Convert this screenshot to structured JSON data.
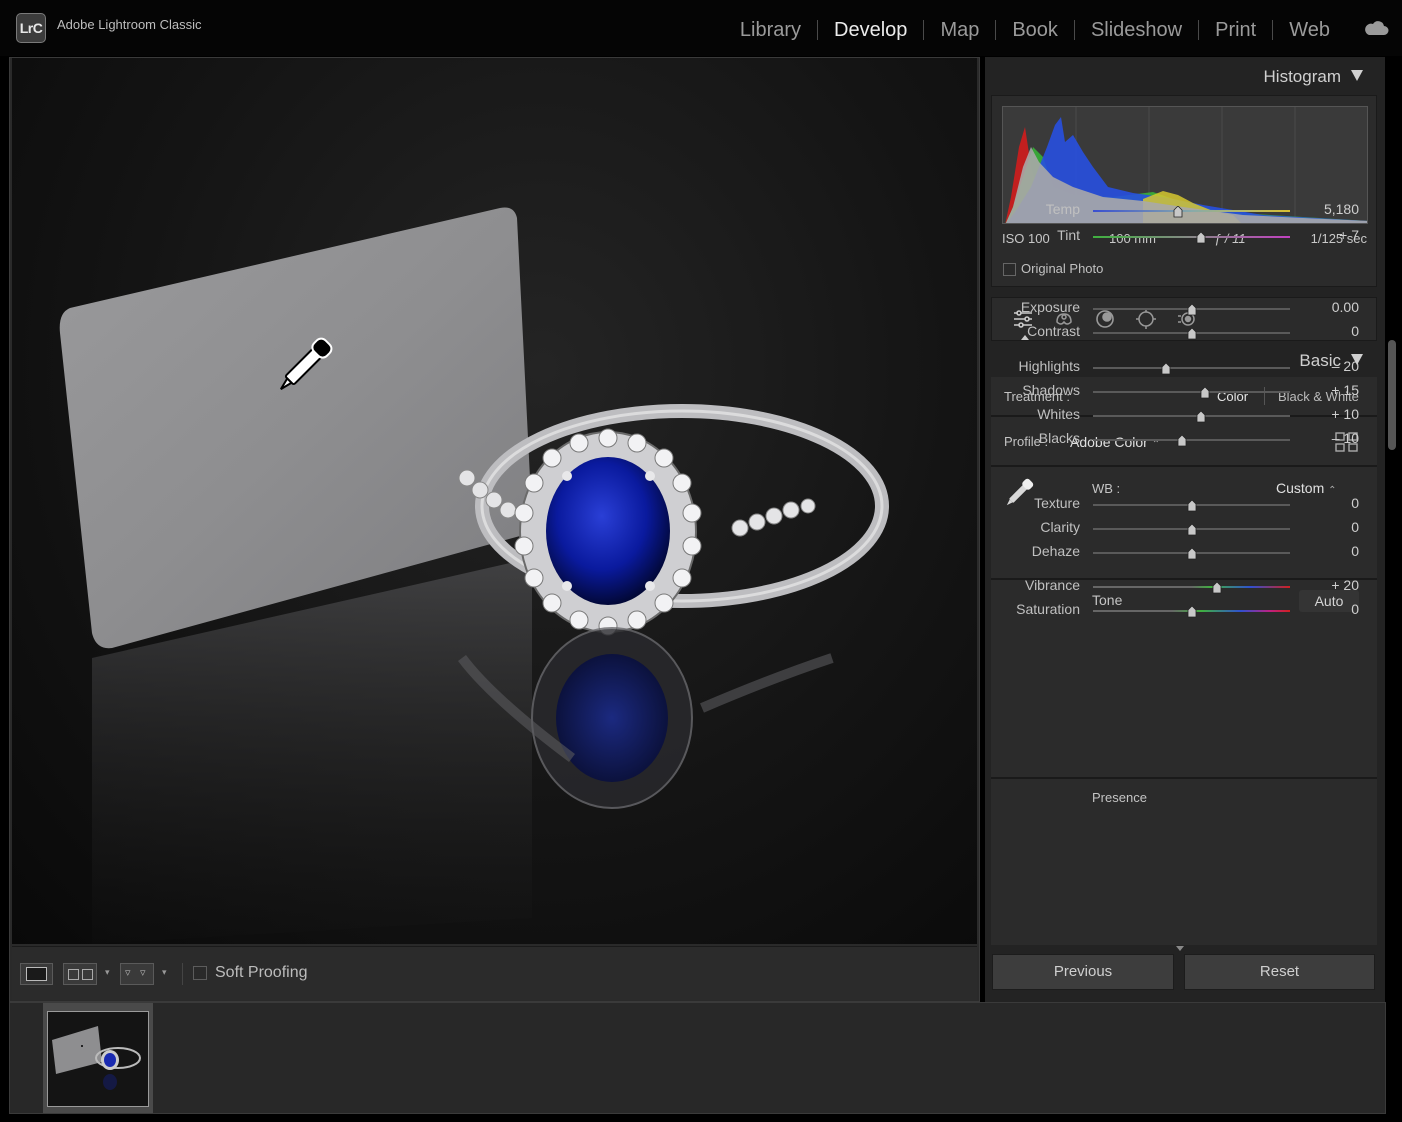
{
  "app": {
    "logo_text": "LrC",
    "title": "Adobe Lightroom Classic"
  },
  "modules": [
    {
      "label": "Library",
      "active": false
    },
    {
      "label": "Develop",
      "active": true
    },
    {
      "label": "Map",
      "active": false
    },
    {
      "label": "Book",
      "active": false
    },
    {
      "label": "Slideshow",
      "active": false
    },
    {
      "label": "Print",
      "active": false
    },
    {
      "label": "Web",
      "active": false
    }
  ],
  "toolbar": {
    "soft_proofing_label": "Soft Proofing",
    "soft_proofing_checked": false
  },
  "histogram": {
    "title": "Histogram",
    "iso": "ISO 100",
    "focal_length": "100 mm",
    "aperture": "ƒ / 11",
    "shutter": "1/125 sec",
    "original_photo_label": "Original Photo"
  },
  "basic": {
    "title": "Basic",
    "treatment_label": "Treatment :",
    "treatment_color": "Color",
    "treatment_bw": "Black & White",
    "profile_label": "Profile :",
    "profile_value": "Adobe Color",
    "wb_label": "WB :",
    "wb_value": "Custom",
    "tone_label": "Tone",
    "auto_label": "Auto",
    "presence_label": "Presence",
    "sliders": [
      {
        "key": "temp",
        "label": "Temp",
        "value": "5,180",
        "position": 0.43
      },
      {
        "key": "tint",
        "label": "Tint",
        "value": "+ 7",
        "position": 0.55
      },
      {
        "key": "exposure",
        "label": "Exposure",
        "value": "0.00",
        "position": 0.5
      },
      {
        "key": "contrast",
        "label": "Contrast",
        "value": "0",
        "position": 0.5
      },
      {
        "key": "highlights",
        "label": "Highlights",
        "value": "– 20",
        "position": 0.37
      },
      {
        "key": "shadows",
        "label": "Shadows",
        "value": "+ 15",
        "position": 0.57
      },
      {
        "key": "whites",
        "label": "Whites",
        "value": "+ 10",
        "position": 0.55
      },
      {
        "key": "blacks",
        "label": "Blacks",
        "value": "– 10",
        "position": 0.45
      },
      {
        "key": "texture",
        "label": "Texture",
        "value": "0",
        "position": 0.5
      },
      {
        "key": "clarity",
        "label": "Clarity",
        "value": "0",
        "position": 0.5
      },
      {
        "key": "dehaze",
        "label": "Dehaze",
        "value": "0",
        "position": 0.5
      },
      {
        "key": "vibrance",
        "label": "Vibrance",
        "value": "+ 20",
        "position": 0.63
      },
      {
        "key": "saturation",
        "label": "Saturation",
        "value": "0",
        "position": 0.5
      }
    ]
  },
  "buttons": {
    "previous": "Previous",
    "reset": "Reset"
  },
  "icons": {
    "cloud": "cloud-icon",
    "eyedropper": "eyedropper-icon",
    "profile_browser": "grid-icon"
  }
}
